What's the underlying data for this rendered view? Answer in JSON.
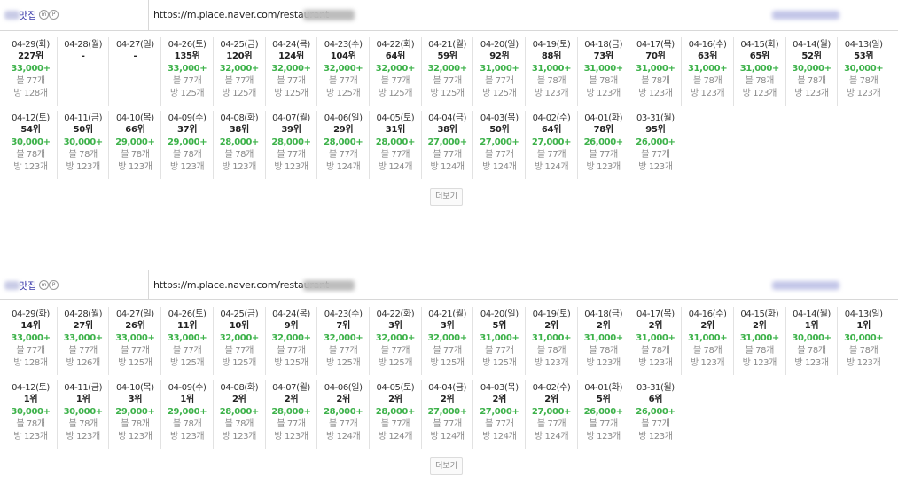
{
  "panels": [
    {
      "shop_label": "맛집",
      "url": "https://m.place.naver.com/restaurant",
      "more_label": "더보기",
      "rows": [
        [
          {
            "date": "04-29(화)",
            "rank": "227위",
            "price": "33,000+",
            "blog": "블 77개",
            "visit": "방 128개"
          },
          {
            "date": "04-28(월)",
            "rank": "-",
            "price": "",
            "blog": "",
            "visit": ""
          },
          {
            "date": "04-27(일)",
            "rank": "-",
            "price": "",
            "blog": "",
            "visit": ""
          },
          {
            "date": "04-26(토)",
            "rank": "135위",
            "price": "33,000+",
            "blog": "블 77개",
            "visit": "방 125개"
          },
          {
            "date": "04-25(금)",
            "rank": "120위",
            "price": "32,000+",
            "blog": "블 77개",
            "visit": "방 125개"
          },
          {
            "date": "04-24(목)",
            "rank": "124위",
            "price": "32,000+",
            "blog": "블 77개",
            "visit": "방 125개"
          },
          {
            "date": "04-23(수)",
            "rank": "104위",
            "price": "32,000+",
            "blog": "블 77개",
            "visit": "방 125개"
          },
          {
            "date": "04-22(화)",
            "rank": "64위",
            "price": "32,000+",
            "blog": "블 77개",
            "visit": "방 125개"
          },
          {
            "date": "04-21(월)",
            "rank": "59위",
            "price": "32,000+",
            "blog": "블 77개",
            "visit": "방 125개"
          },
          {
            "date": "04-20(일)",
            "rank": "92위",
            "price": "31,000+",
            "blog": "블 77개",
            "visit": "방 125개"
          },
          {
            "date": "04-19(토)",
            "rank": "88위",
            "price": "31,000+",
            "blog": "블 78개",
            "visit": "방 123개"
          },
          {
            "date": "04-18(금)",
            "rank": "73위",
            "price": "31,000+",
            "blog": "블 78개",
            "visit": "방 123개"
          },
          {
            "date": "04-17(목)",
            "rank": "70위",
            "price": "31,000+",
            "blog": "블 78개",
            "visit": "방 123개"
          },
          {
            "date": "04-16(수)",
            "rank": "63위",
            "price": "31,000+",
            "blog": "블 78개",
            "visit": "방 123개"
          },
          {
            "date": "04-15(화)",
            "rank": "65위",
            "price": "31,000+",
            "blog": "블 78개",
            "visit": "방 123개"
          },
          {
            "date": "04-14(월)",
            "rank": "52위",
            "price": "30,000+",
            "blog": "블 78개",
            "visit": "방 123개"
          },
          {
            "date": "04-13(일)",
            "rank": "53위",
            "price": "30,000+",
            "blog": "블 78개",
            "visit": "방 123개"
          }
        ],
        [
          {
            "date": "04-12(토)",
            "rank": "54위",
            "price": "30,000+",
            "blog": "블 78개",
            "visit": "방 123개"
          },
          {
            "date": "04-11(금)",
            "rank": "50위",
            "price": "30,000+",
            "blog": "블 78개",
            "visit": "방 123개"
          },
          {
            "date": "04-10(목)",
            "rank": "66위",
            "price": "29,000+",
            "blog": "블 78개",
            "visit": "방 123개"
          },
          {
            "date": "04-09(수)",
            "rank": "37위",
            "price": "29,000+",
            "blog": "블 78개",
            "visit": "방 123개"
          },
          {
            "date": "04-08(화)",
            "rank": "38위",
            "price": "28,000+",
            "blog": "블 78개",
            "visit": "방 123개"
          },
          {
            "date": "04-07(월)",
            "rank": "39위",
            "price": "28,000+",
            "blog": "블 77개",
            "visit": "방 123개"
          },
          {
            "date": "04-06(일)",
            "rank": "29위",
            "price": "28,000+",
            "blog": "블 77개",
            "visit": "방 124개"
          },
          {
            "date": "04-05(토)",
            "rank": "31위",
            "price": "28,000+",
            "blog": "블 77개",
            "visit": "방 124개"
          },
          {
            "date": "04-04(금)",
            "rank": "38위",
            "price": "27,000+",
            "blog": "블 77개",
            "visit": "방 124개"
          },
          {
            "date": "04-03(목)",
            "rank": "50위",
            "price": "27,000+",
            "blog": "블 77개",
            "visit": "방 124개"
          },
          {
            "date": "04-02(수)",
            "rank": "64위",
            "price": "27,000+",
            "blog": "블 77개",
            "visit": "방 124개"
          },
          {
            "date": "04-01(화)",
            "rank": "78위",
            "price": "26,000+",
            "blog": "블 77개",
            "visit": "방 123개"
          },
          {
            "date": "03-31(월)",
            "rank": "95위",
            "price": "26,000+",
            "blog": "블 77개",
            "visit": "방 123개"
          }
        ]
      ]
    },
    {
      "shop_label": "맛집",
      "url": "https://m.place.naver.com/restaurant",
      "more_label": "더보기",
      "rows": [
        [
          {
            "date": "04-29(화)",
            "rank": "14위",
            "price": "33,000+",
            "blog": "블 77개",
            "visit": "방 128개"
          },
          {
            "date": "04-28(월)",
            "rank": "27위",
            "price": "33,000+",
            "blog": "블 77개",
            "visit": "방 126개"
          },
          {
            "date": "04-27(일)",
            "rank": "26위",
            "price": "33,000+",
            "blog": "블 77개",
            "visit": "방 125개"
          },
          {
            "date": "04-26(토)",
            "rank": "11위",
            "price": "33,000+",
            "blog": "블 77개",
            "visit": "방 125개"
          },
          {
            "date": "04-25(금)",
            "rank": "10위",
            "price": "32,000+",
            "blog": "블 77개",
            "visit": "방 125개"
          },
          {
            "date": "04-24(목)",
            "rank": "9위",
            "price": "32,000+",
            "blog": "블 77개",
            "visit": "방 125개"
          },
          {
            "date": "04-23(수)",
            "rank": "7위",
            "price": "32,000+",
            "blog": "블 77개",
            "visit": "방 125개"
          },
          {
            "date": "04-22(화)",
            "rank": "3위",
            "price": "32,000+",
            "blog": "블 77개",
            "visit": "방 125개"
          },
          {
            "date": "04-21(월)",
            "rank": "3위",
            "price": "32,000+",
            "blog": "블 77개",
            "visit": "방 125개"
          },
          {
            "date": "04-20(일)",
            "rank": "5위",
            "price": "31,000+",
            "blog": "블 77개",
            "visit": "방 125개"
          },
          {
            "date": "04-19(토)",
            "rank": "2위",
            "price": "31,000+",
            "blog": "블 78개",
            "visit": "방 123개"
          },
          {
            "date": "04-18(금)",
            "rank": "2위",
            "price": "31,000+",
            "blog": "블 78개",
            "visit": "방 123개"
          },
          {
            "date": "04-17(목)",
            "rank": "2위",
            "price": "31,000+",
            "blog": "블 78개",
            "visit": "방 123개"
          },
          {
            "date": "04-16(수)",
            "rank": "2위",
            "price": "31,000+",
            "blog": "블 78개",
            "visit": "방 123개"
          },
          {
            "date": "04-15(화)",
            "rank": "2위",
            "price": "31,000+",
            "blog": "블 78개",
            "visit": "방 123개"
          },
          {
            "date": "04-14(월)",
            "rank": "1위",
            "price": "30,000+",
            "blog": "블 78개",
            "visit": "방 123개"
          },
          {
            "date": "04-13(일)",
            "rank": "1위",
            "price": "30,000+",
            "blog": "블 78개",
            "visit": "방 123개"
          }
        ],
        [
          {
            "date": "04-12(토)",
            "rank": "1위",
            "price": "30,000+",
            "blog": "블 78개",
            "visit": "방 123개"
          },
          {
            "date": "04-11(금)",
            "rank": "1위",
            "price": "30,000+",
            "blog": "블 78개",
            "visit": "방 123개"
          },
          {
            "date": "04-10(목)",
            "rank": "3위",
            "price": "29,000+",
            "blog": "블 78개",
            "visit": "방 123개"
          },
          {
            "date": "04-09(수)",
            "rank": "1위",
            "price": "29,000+",
            "blog": "블 78개",
            "visit": "방 123개"
          },
          {
            "date": "04-08(화)",
            "rank": "2위",
            "price": "28,000+",
            "blog": "블 78개",
            "visit": "방 123개"
          },
          {
            "date": "04-07(월)",
            "rank": "2위",
            "price": "28,000+",
            "blog": "블 77개",
            "visit": "방 123개"
          },
          {
            "date": "04-06(일)",
            "rank": "2위",
            "price": "28,000+",
            "blog": "블 77개",
            "visit": "방 124개"
          },
          {
            "date": "04-05(토)",
            "rank": "2위",
            "price": "28,000+",
            "blog": "블 77개",
            "visit": "방 124개"
          },
          {
            "date": "04-04(금)",
            "rank": "2위",
            "price": "27,000+",
            "blog": "블 77개",
            "visit": "방 124개"
          },
          {
            "date": "04-03(목)",
            "rank": "2위",
            "price": "27,000+",
            "blog": "블 77개",
            "visit": "방 124개"
          },
          {
            "date": "04-02(수)",
            "rank": "2위",
            "price": "27,000+",
            "blog": "블 77개",
            "visit": "방 124개"
          },
          {
            "date": "04-01(화)",
            "rank": "5위",
            "price": "26,000+",
            "blog": "블 77개",
            "visit": "방 123개"
          },
          {
            "date": "03-31(월)",
            "rank": "6위",
            "price": "26,000+",
            "blog": "블 77개",
            "visit": "방 123개"
          }
        ]
      ]
    }
  ],
  "colors": {
    "price_green": "#3db24a",
    "shop_label_blue": "#3a3aaa",
    "muted_gray": "#8a8a8a",
    "divider": "#e2e2e2"
  }
}
